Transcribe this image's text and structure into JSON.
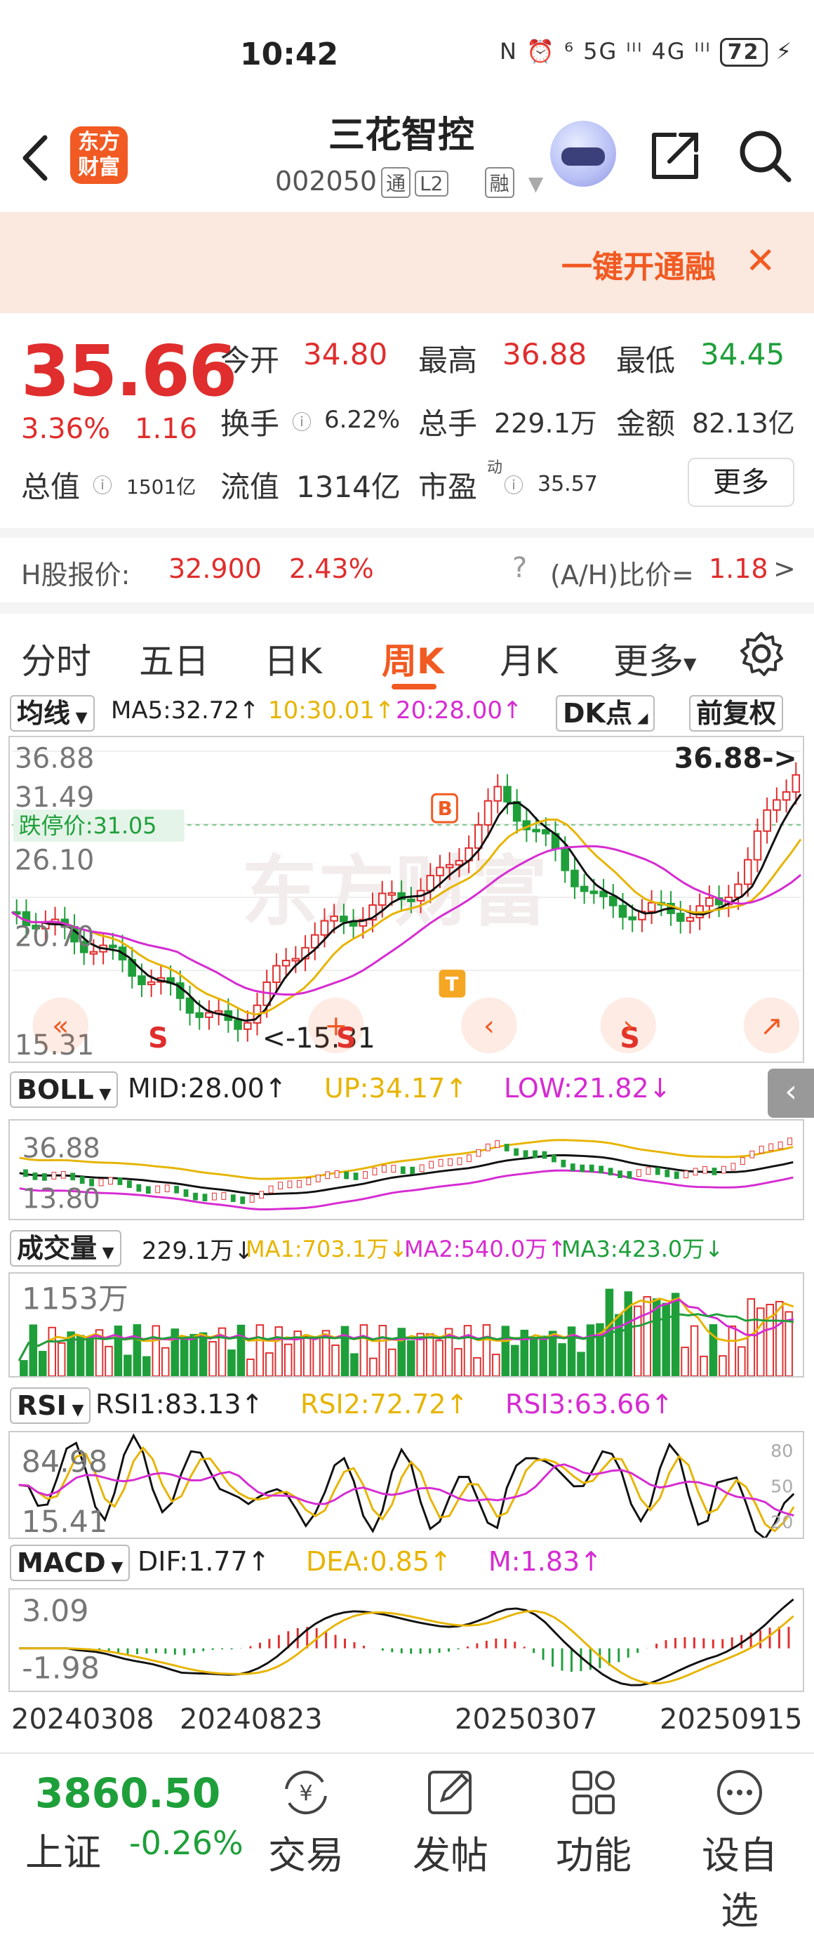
{
  "status": {
    "time": "10:42",
    "icons": "N ⏰ ⁶ 5G ᴵᴵᴵ 4G ᴵᴵᴵ",
    "battery": "72"
  },
  "header": {
    "logo_line1": "东方",
    "logo_line2": "财富",
    "name": "三花智控",
    "code": "002050",
    "tag_tong": "通",
    "tag_l2": "L2",
    "tag_rong": "融"
  },
  "banner": {
    "text": "一键开通融",
    "close": "✕"
  },
  "quote": {
    "price": "35.66",
    "change_pct": "3.36%",
    "change_abs": "1.16",
    "open_label": "今开",
    "open": "34.80",
    "high_label": "最高",
    "high": "36.88",
    "low_label": "最低",
    "low": "34.45",
    "turnover_label": "换手",
    "turnover": "6.22%",
    "volume_label": "总手",
    "volume": "229.1万",
    "amount_label": "金额",
    "amount": "82.13亿",
    "mktcap_label": "总值",
    "mktcap": "1501亿",
    "float_label": "流值",
    "float": "1314亿",
    "pe_label": "市盈",
    "pe_sup": "动",
    "pe": "35.57",
    "more": "更多"
  },
  "hshare": {
    "label": "H股报价:",
    "price": "32.900",
    "pct": "2.43%",
    "ratio_label": "(A/H)比价=",
    "ratio": "1.18",
    "arrow": ">"
  },
  "tabs": [
    "分时",
    "五日",
    "日K",
    "周K",
    "月K",
    "更多"
  ],
  "active_tab": "周K",
  "ma_header": {
    "dropdown": "均线",
    "ma5": "MA5:32.72↑",
    "ma10": "10:30.01↑",
    "ma20": "20:28.00↑",
    "dk": "DK点",
    "fq": "前复权"
  },
  "main_chart": {
    "y_top": "36.88",
    "y_2": "31.49",
    "y_3": "26.10",
    "y_4": "20.70",
    "y_low": "15.31",
    "limit_label": "跌停价:31.05",
    "high_mark": "36.88->",
    "low_mark": "<-15.31",
    "watermark": "东方财富",
    "b_mark": "B",
    "t_mark": "T",
    "s_mark": "S"
  },
  "boll": {
    "dropdown": "BOLL",
    "mid": "MID:28.00↑",
    "up": "UP:34.17↑",
    "low": "LOW:21.82↓",
    "y_top": "36.88",
    "y_low": "13.80"
  },
  "vol": {
    "dropdown": "成交量",
    "val": "229.1万↓",
    "ma1": "MA1:703.1万↓",
    "ma2": "MA2:540.0万↑",
    "ma3": "MA3:423.0万↓",
    "y_top": "1153万"
  },
  "rsi": {
    "dropdown": "RSI",
    "r1": "RSI1:83.13↑",
    "r2": "RSI2:72.72↑",
    "r3": "RSI3:63.66↑",
    "y_top": "84.98",
    "y_low": "15.41",
    "g80": "80",
    "g50": "50",
    "g20": "20"
  },
  "macd": {
    "dropdown": "MACD",
    "dif": "DIF:1.77↑",
    "dea": "DEA:0.85↑",
    "m": "M:1.83↑",
    "y_top": "3.09",
    "y_low": "-1.98"
  },
  "dates": [
    "20240308",
    "20240823",
    "20250307",
    "20250915"
  ],
  "bottom": {
    "index_value": "3860.50",
    "index_name": "上证",
    "index_pct": "-0.26%",
    "nav": [
      "交易",
      "发帖",
      "功能",
      "设自选"
    ]
  },
  "colors": {
    "accent": "#f15a22",
    "up": "#e02d2d",
    "down": "#1e9f3a",
    "ma10": "#e7b400",
    "ma20": "#d62bd2"
  }
}
